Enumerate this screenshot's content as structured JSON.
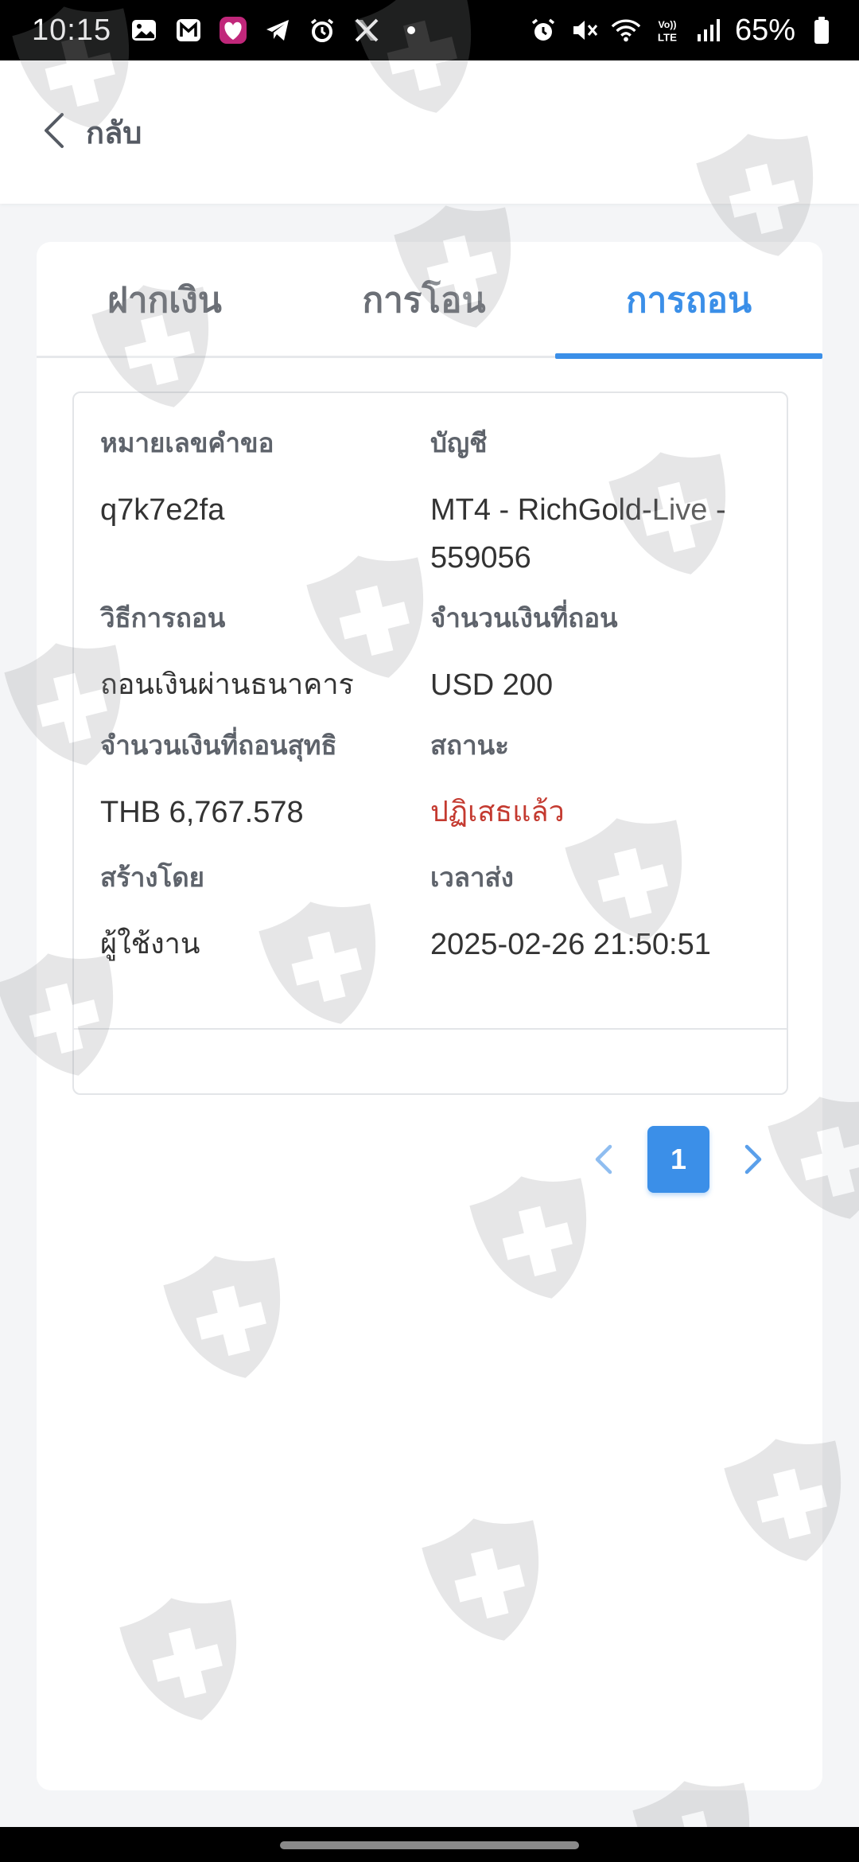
{
  "status_bar": {
    "time": "10:15",
    "left_icons": [
      "gallery-icon",
      "gmail-icon",
      "lazada-icon",
      "telegram-icon",
      "alarm-icon",
      "x-icon",
      "dot-icon"
    ],
    "right_icons": [
      "alarm-icon",
      "mute-icon",
      "wifi-icon",
      "volte-icon",
      "signal-icon",
      "battery-icon"
    ],
    "battery": "65%"
  },
  "header": {
    "back_label": "กลับ"
  },
  "tabs": [
    {
      "label": "ฝากเงิน",
      "active": false
    },
    {
      "label": "การโอน",
      "active": false
    },
    {
      "label": "การถอน",
      "active": true
    }
  ],
  "withdrawal": {
    "request_number_label": "หมายเลขคำขอ",
    "request_number": "q7k7e2fa",
    "account_label": "บัญชี",
    "account": "MT4 - RichGold-Live - 559056",
    "method_label": "วิธีการถอน",
    "method": "ถอนเงินผ่านธนาคาร",
    "amount_label": "จำนวนเงินที่ถอน",
    "amount": "USD 200",
    "net_amount_label": "จำนวนเงินที่ถอนสุทธิ",
    "net_amount": "THB 6,767.578",
    "status_label": "สถานะ",
    "status": "ปฏิเสธแล้ว",
    "created_by_label": "สร้างโดย",
    "created_by": "ผู้ใช้งาน",
    "submitted_time_label": "เวลาส่ง",
    "submitted_time": "2025-02-26 21:50:51"
  },
  "pagination": {
    "current_page": "1"
  },
  "colors": {
    "accent": "#3b8fe8",
    "rejected": "#c43a30",
    "background": "#f4f5f7"
  }
}
